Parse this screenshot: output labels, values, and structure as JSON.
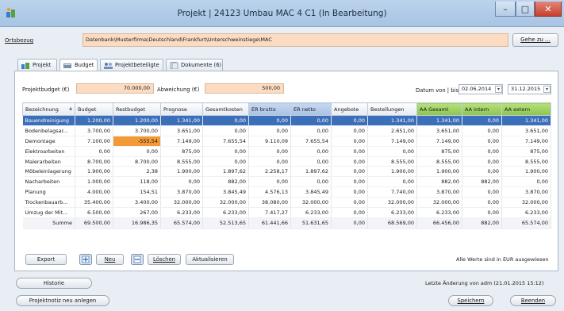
{
  "window": {
    "title": "Projekt | 24123 Umbau MAC 4 C1 (In Bearbeitung)",
    "min_glyph": "–",
    "max_glyph": "□",
    "close_glyph": "✕"
  },
  "path": {
    "label": "Ortsbezug",
    "value": "Datenbank\\Musterfirma\\Deutschland\\Frankfurt\\Unterschweinstiege\\MAC",
    "goto_label": "Gehe zu ..."
  },
  "tabs": [
    {
      "label": "Projekt",
      "icon": "project-icon"
    },
    {
      "label": "Budget",
      "icon": "budget-icon"
    },
    {
      "label": "Projektbeteiligte",
      "icon": "participants-icon"
    },
    {
      "label": "Dokumente (6)",
      "icon": "documents-icon"
    }
  ],
  "budget": {
    "label": "Projektbudget (€)",
    "value": "70.000,00",
    "deviation_label": "Abweichung (€)",
    "deviation_value": "500,00",
    "date_label": "Datum von | bis",
    "date_from": "02.06.2014",
    "date_to": "31.12.2015",
    "dropdown_glyph": "▾"
  },
  "table": {
    "columns": [
      "Bezeichnung",
      "Budget",
      "Restbudget",
      "Prognose",
      "Gesamtkosten",
      "ER brutto",
      "ER netto",
      "Angebote",
      "Bestellungen",
      "AA Gesamt",
      "AA intern",
      "AA extern"
    ],
    "sort_glyph": "▲",
    "rows": [
      [
        "Bauendreinigung",
        "1.200,00",
        "1.200,00",
        "1.341,00",
        "0,00",
        "0,00",
        "0,00",
        "0,00",
        "1.341,00",
        "1.341,00",
        "0,00",
        "1.341,00"
      ],
      [
        "Bodenbelagsar...",
        "3.700,00",
        "3.700,00",
        "3.651,00",
        "0,00",
        "0,00",
        "0,00",
        "0,00",
        "2.651,00",
        "3.651,00",
        "0,00",
        "3.651,00"
      ],
      [
        "Demontage",
        "7.100,00",
        "-555,54",
        "7.149,00",
        "7.655,54",
        "9.110,09",
        "7.655,54",
        "0,00",
        "7.149,00",
        "7.149,00",
        "0,00",
        "7.149,00"
      ],
      [
        "Elektroarbeiten",
        "0,00",
        "0,00",
        "875,00",
        "0,00",
        "0,00",
        "0,00",
        "0,00",
        "0,00",
        "875,00",
        "0,00",
        "875,00"
      ],
      [
        "Malerarbeiten",
        "8.700,00",
        "8.700,00",
        "8.555,00",
        "0,00",
        "0,00",
        "0,00",
        "0,00",
        "8.555,00",
        "8.555,00",
        "0,00",
        "8.555,00"
      ],
      [
        "Möbeleinlagerung",
        "1.900,00",
        "2,38",
        "1.900,00",
        "1.897,62",
        "2.258,17",
        "1.897,62",
        "0,00",
        "1.900,00",
        "1.900,00",
        "0,00",
        "1.900,00"
      ],
      [
        "Nacharbeiten",
        "1.000,00",
        "118,00",
        "0,00",
        "882,00",
        "0,00",
        "0,00",
        "0,00",
        "0,00",
        "882,00",
        "882,00",
        "0,00"
      ],
      [
        "Planung",
        "4.000,00",
        "154,51",
        "3.870,00",
        "3.845,49",
        "4.576,13",
        "3.845,49",
        "0,00",
        "7.740,00",
        "3.870,00",
        "0,00",
        "3.870,00"
      ],
      [
        "Trockenbauarb...",
        "35.400,00",
        "3.400,00",
        "32.000,00",
        "32.000,00",
        "38.080,00",
        "32.000,00",
        "0,00",
        "32.000,00",
        "32.000,00",
        "0,00",
        "32.000,00"
      ],
      [
        "Umzug der Mit...",
        "6.500,00",
        "267,00",
        "6.233,00",
        "6.233,00",
        "7.417,27",
        "6.233,00",
        "0,00",
        "6.233,00",
        "6.233,00",
        "0,00",
        "6.233,00"
      ]
    ],
    "sum_row": [
      "Summe",
      "69.500,00",
      "16.986,35",
      "65.574,00",
      "52.513,65",
      "61.441,66",
      "51.631,65",
      "0,00",
      "68.569,00",
      "66.456,00",
      "882,00",
      "65.574,00"
    ]
  },
  "actions": {
    "export": "Export",
    "new": "Neu",
    "delete": "Löschen",
    "refresh": "Aktualisieren",
    "currency_note": "Alle Werte sind in EUR ausgewiesen"
  },
  "footer": {
    "history": "Historie",
    "last_change": "Letzte Änderung von adm (21.01.2015 15:12)",
    "new_note": "Projektnotiz neu anlegen",
    "save": "Speichern",
    "close": "Beenden"
  },
  "colors": {
    "selection": "#3c6fb9",
    "negative": "#f39a36",
    "highlight_green": "#8cc44c",
    "highlight_blue": "#a9c2e6",
    "field_orange": "#fbdcc2"
  }
}
